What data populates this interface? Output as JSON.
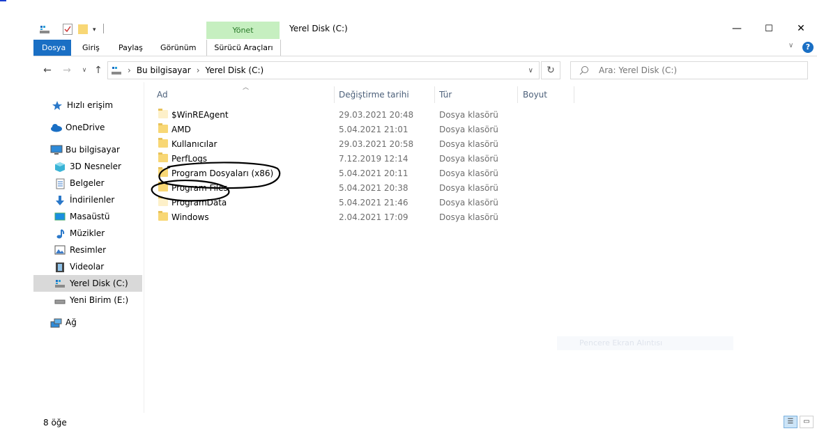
{
  "window": {
    "title": "Yerel Disk (C:)",
    "contextual_tab_group": "Yönet",
    "minimize_glyph": "—",
    "maximize_glyph": "☐",
    "close_glyph": "✕"
  },
  "ribbon": {
    "tabs": [
      "Dosya",
      "Giriş",
      "Paylaş",
      "Görünüm",
      "Sürücü Araçları"
    ],
    "help_glyph": "?",
    "collapse_glyph": "∨"
  },
  "nav": {
    "back_glyph": "←",
    "forward_glyph": "→",
    "recent_glyph": "∨",
    "up_glyph": "↑",
    "refresh_glyph": "↻",
    "dropdown_glyph": "∨"
  },
  "address": {
    "sep": "›",
    "crumbs": [
      "Bu bilgisayar",
      "Yerel Disk (C:)"
    ]
  },
  "search": {
    "placeholder": "Ara: Yerel Disk (C:)"
  },
  "sidebar": {
    "items": [
      {
        "label": "Hızlı erişim",
        "icon": "star-icon"
      },
      {
        "label": "OneDrive",
        "icon": "cloud-icon"
      },
      {
        "label": "Bu bilgisayar",
        "icon": "computer-icon"
      },
      {
        "label": "3D Nesneler",
        "icon": "cube-icon"
      },
      {
        "label": "Belgeler",
        "icon": "document-icon"
      },
      {
        "label": "İndirilenler",
        "icon": "download-icon"
      },
      {
        "label": "Masaüstü",
        "icon": "desktop-icon"
      },
      {
        "label": "Müzikler",
        "icon": "music-icon"
      },
      {
        "label": "Resimler",
        "icon": "picture-icon"
      },
      {
        "label": "Videolar",
        "icon": "video-icon"
      },
      {
        "label": "Yerel Disk (C:)",
        "icon": "drive-icon"
      },
      {
        "label": "Yeni Birim (E:)",
        "icon": "drive-icon"
      },
      {
        "label": "Ağ",
        "icon": "network-icon"
      }
    ]
  },
  "columns": {
    "name": "Ad",
    "date": "Değiştirme tarihi",
    "type": "Tür",
    "size": "Boyut"
  },
  "files": [
    {
      "name": "$WinREAgent",
      "date": "29.03.2021 20:48",
      "type": "Dosya klasörü"
    },
    {
      "name": "AMD",
      "date": "5.04.2021 21:01",
      "type": "Dosya klasörü"
    },
    {
      "name": "Kullanıcılar",
      "date": "29.03.2021 20:58",
      "type": "Dosya klasörü"
    },
    {
      "name": "PerfLogs",
      "date": "7.12.2019 12:14",
      "type": "Dosya klasörü"
    },
    {
      "name": "Program Dosyaları (x86)",
      "date": "5.04.2021 20:11",
      "type": "Dosya klasörü"
    },
    {
      "name": "Program Files",
      "date": "5.04.2021 20:38",
      "type": "Dosya klasörü"
    },
    {
      "name": "ProgramData",
      "date": "5.04.2021 21:46",
      "type": "Dosya klasörü"
    },
    {
      "name": "Windows",
      "date": "2.04.2021 17:09",
      "type": "Dosya klasörü"
    }
  ],
  "status": {
    "item_count": "8 öğe"
  },
  "ghost_text": "Pencere Ekran Alıntısı",
  "colors": {
    "accent": "#1a6fc4",
    "contextual_green": "#c6efc0",
    "selected_bg": "#d9d9d9",
    "annotation_ink": "#000000"
  }
}
